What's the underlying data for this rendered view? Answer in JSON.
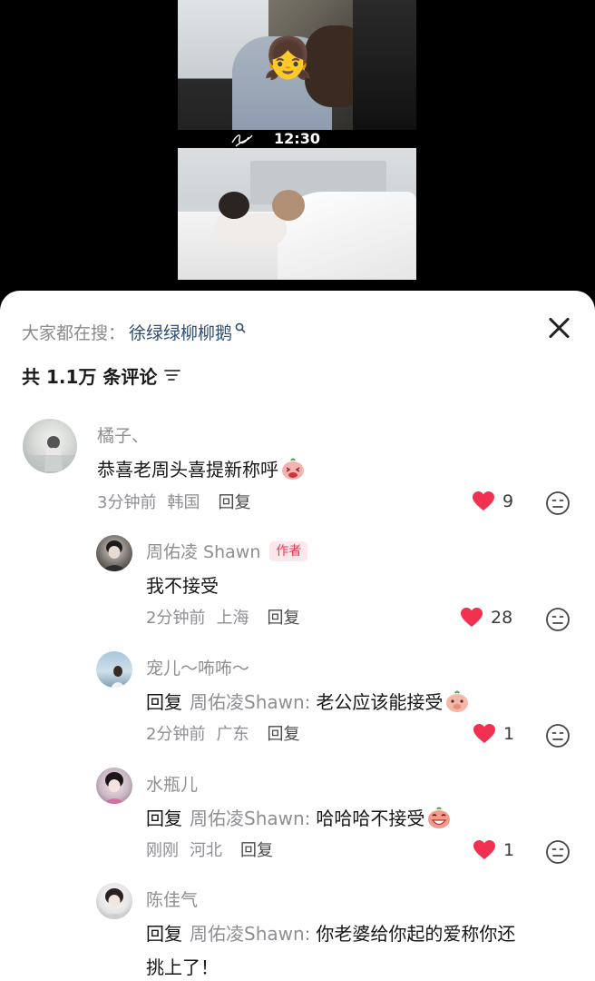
{
  "video": {
    "time_label": "12:30"
  },
  "search": {
    "prefix": "大家都在搜：",
    "term": "徐绿绿柳柳鹅"
  },
  "comments_header": {
    "count_label": "共 1.1万 条评论"
  },
  "comments": [
    {
      "user": "橘子、",
      "text": "恭喜老周头喜提新称呼",
      "time": "3分钟前",
      "location": "韩国",
      "reply_label": "回复",
      "likes": "9"
    },
    {
      "user": "周佑凌 Shawn",
      "badge": "作者",
      "text": "我不接受",
      "time": "2分钟前",
      "location": "上海",
      "reply_label": "回复",
      "likes": "28"
    },
    {
      "user": "宠儿～咘咘～",
      "reply_word": "回复",
      "reply_to": "周佑凌Shawn:",
      "text": "老公应该能接受",
      "time": "2分钟前",
      "location": "广东",
      "reply_label": "回复",
      "likes": "1"
    },
    {
      "user": "水瓶儿",
      "reply_word": "回复",
      "reply_to": "周佑凌Shawn:",
      "text": "哈哈哈不接受",
      "time": "刚刚",
      "location": "河北",
      "reply_label": "回复",
      "likes": "1"
    },
    {
      "user": "陈佳气",
      "reply_word": "回复",
      "reply_to": "周佑凌Shawn:",
      "text": "你老婆给你起的爱称你还",
      "text_line2": "挑上了！"
    }
  ],
  "colors": {
    "like_red": "#f2304f",
    "link_blue": "#2f4d73",
    "meta_gray": "#8e8e93"
  }
}
